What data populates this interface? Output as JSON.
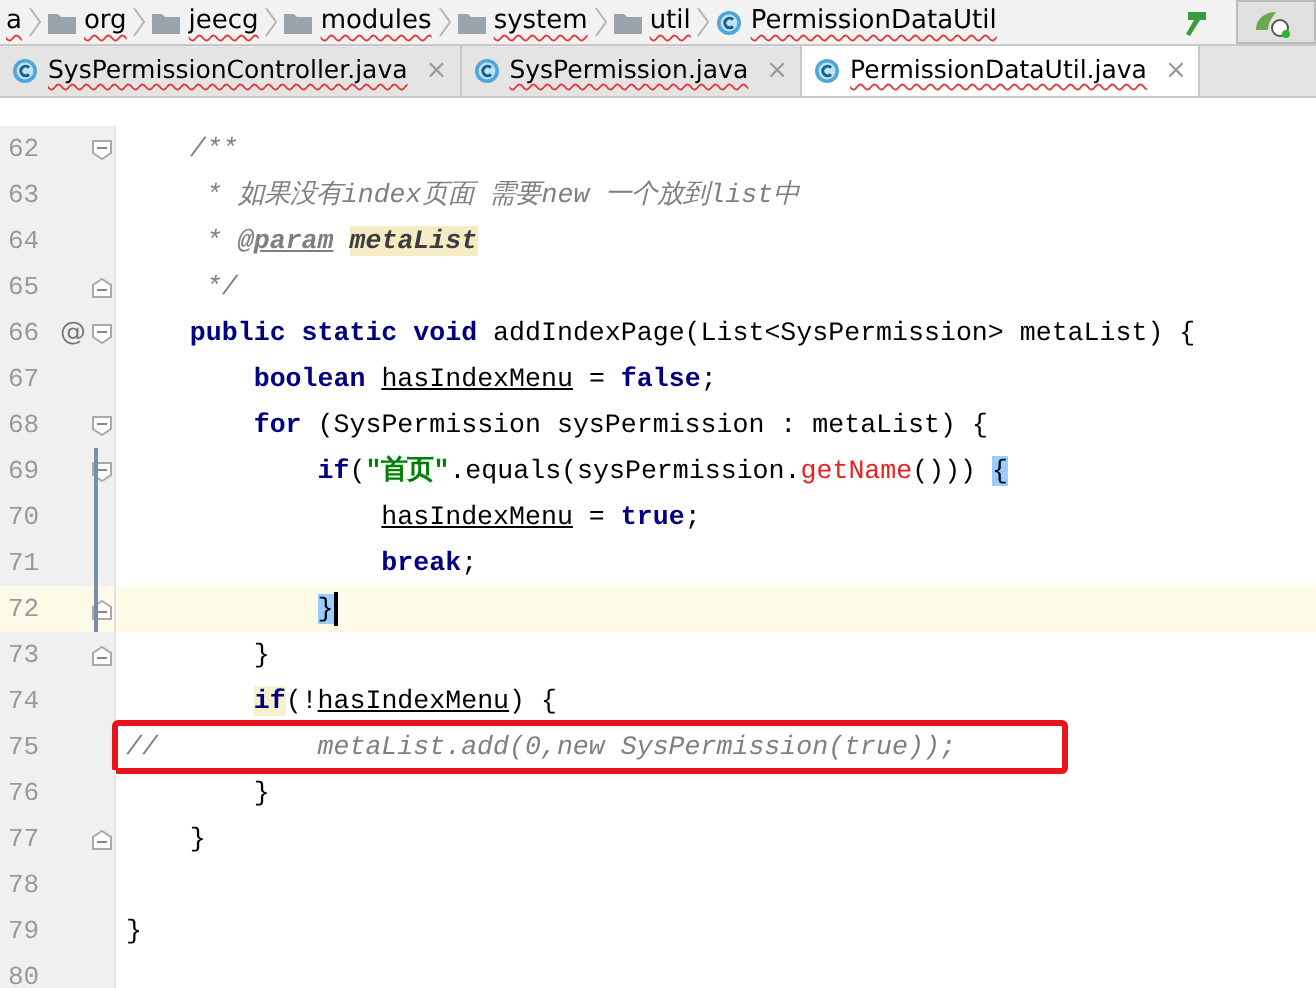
{
  "breadcrumb": [
    {
      "label": "a",
      "kind": "text"
    },
    {
      "label": "org",
      "kind": "folder"
    },
    {
      "label": "jeecg",
      "kind": "folder"
    },
    {
      "label": "modules",
      "kind": "folder"
    },
    {
      "label": "system",
      "kind": "folder"
    },
    {
      "label": "util",
      "kind": "folder"
    },
    {
      "label": "PermissionDataUtil",
      "kind": "class"
    }
  ],
  "tabs": [
    {
      "label": "SysPermissionController.java",
      "close": "×",
      "selected": false
    },
    {
      "label": "SysPermission.java",
      "close": "×",
      "selected": false
    },
    {
      "label": "PermissionDataUtil.java",
      "close": "×",
      "selected": true
    }
  ],
  "lines": [
    {
      "number": "62",
      "fold_start": true,
      "segments": [
        {
          "text": "    /**",
          "kind": "doc"
        }
      ]
    },
    {
      "number": "63",
      "segments": [
        {
          "text": "     * 如果没有index页面 需要new 一个放到list中",
          "kind": "doc"
        }
      ]
    },
    {
      "number": "64",
      "segments": [
        {
          "text": "     * ",
          "kind": "doc"
        },
        {
          "text": "@param",
          "kind": "doc-tag"
        },
        {
          "text": " metaList",
          "kind": "doc-param",
          "usage": true
        }
      ]
    },
    {
      "number": "65",
      "fold_end": true,
      "segments": [
        {
          "text": "     */",
          "kind": "doc"
        }
      ]
    },
    {
      "number": "66",
      "marker": "@",
      "fold_start": true,
      "segments": [
        {
          "text": "    public static void",
          "kind": "keyword"
        },
        {
          "text": " addIndexPage(List<SysPermission> metaList) {",
          "kind": "plain"
        }
      ]
    },
    {
      "number": "67",
      "segments": [
        {
          "text": "        boolean",
          "kind": "keyword"
        },
        {
          "text": " hasIndexMenu",
          "kind": "reassigned"
        },
        {
          "text": " = ",
          "kind": "plain"
        },
        {
          "text": "false",
          "kind": "keyword"
        },
        {
          "text": ";",
          "kind": "plain"
        }
      ]
    },
    {
      "number": "68",
      "fold_start": true,
      "segments": [
        {
          "text": "        for",
          "kind": "keyword"
        },
        {
          "text": " (SysPermission sysPermission : metaList) {",
          "kind": "plain"
        }
      ]
    },
    {
      "number": "69",
      "fold_start": true,
      "changed": true,
      "segments": [
        {
          "text": "            if",
          "kind": "keyword"
        },
        {
          "text": "(",
          "kind": "plain"
        },
        {
          "text": "\"首页\"",
          "kind": "string"
        },
        {
          "text": ".equals(sysPermission.",
          "kind": "plain"
        },
        {
          "text": "getName",
          "kind": "call"
        },
        {
          "text": "()))",
          "kind": "plain"
        },
        {
          "text": " {",
          "kind": "plain",
          "matched": true
        }
      ]
    },
    {
      "number": "70",
      "changed": true,
      "segments": [
        {
          "text": "                hasIndexMenu",
          "kind": "reassigned"
        },
        {
          "text": " = ",
          "kind": "plain"
        },
        {
          "text": "true",
          "kind": "keyword"
        },
        {
          "text": ";",
          "kind": "plain"
        }
      ]
    },
    {
      "number": "71",
      "changed": true,
      "segments": [
        {
          "text": "                break",
          "kind": "keyword"
        },
        {
          "text": ";",
          "kind": "plain"
        }
      ]
    },
    {
      "number": "72",
      "fold_end": true,
      "changed": true,
      "current": true,
      "segments": [
        {
          "text": "            }",
          "kind": "plain",
          "matched": true
        }
      ]
    },
    {
      "number": "73",
      "fold_end": true,
      "segments": [
        {
          "text": "        }",
          "kind": "plain"
        }
      ]
    },
    {
      "number": "74",
      "segments": [
        {
          "text": "        if",
          "kind": "keyword",
          "hint": true
        },
        {
          "text": "(!",
          "kind": "plain"
        },
        {
          "text": "hasIndexMenu",
          "kind": "reassigned"
        },
        {
          "text": ") {",
          "kind": "plain"
        }
      ]
    },
    {
      "number": "75",
      "boxed": true,
      "segments": [
        {
          "text": "//          metaList.add(0,new SysPermission(true));",
          "kind": "comment"
        }
      ]
    },
    {
      "number": "76",
      "segments": [
        {
          "text": "        }",
          "kind": "plain"
        }
      ]
    },
    {
      "number": "77",
      "fold_end": true,
      "segments": [
        {
          "text": "    }",
          "kind": "plain"
        }
      ]
    },
    {
      "number": "78"
    },
    {
      "number": "79",
      "segments": [
        {
          "text": "}",
          "kind": "plain"
        }
      ]
    },
    {
      "number": "80"
    }
  ]
}
